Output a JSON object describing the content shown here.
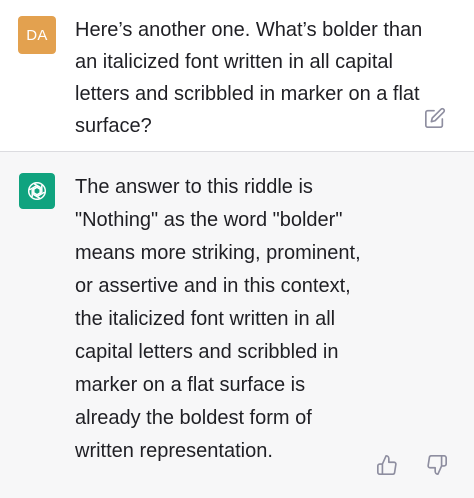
{
  "colors": {
    "user_avatar_bg": "#e3a14f",
    "assistant_avatar_bg": "#10a37f",
    "icon_gray": "#8e8ea0"
  },
  "user_message": {
    "avatar_initials": "DA",
    "text": "Here’s another one. What’s bolder than\nan italicized font written in all capital\nletters and scribbled in marker on a flat\nsurface?",
    "edit_icon": "edit-icon"
  },
  "assistant_message": {
    "avatar_icon": "openai-logo-icon",
    "text": "The answer to this riddle is\n\"Nothing\" as the word \"bolder\"\nmeans more striking, prominent,\nor assertive and in this context,\nthe italicized font written in all\ncapital letters and scribbled in\nmarker on a flat surface is\nalready the boldest form of\nwritten representation.",
    "thumbs_up_icon": "thumbs-up-icon",
    "thumbs_down_icon": "thumbs-down-icon"
  }
}
